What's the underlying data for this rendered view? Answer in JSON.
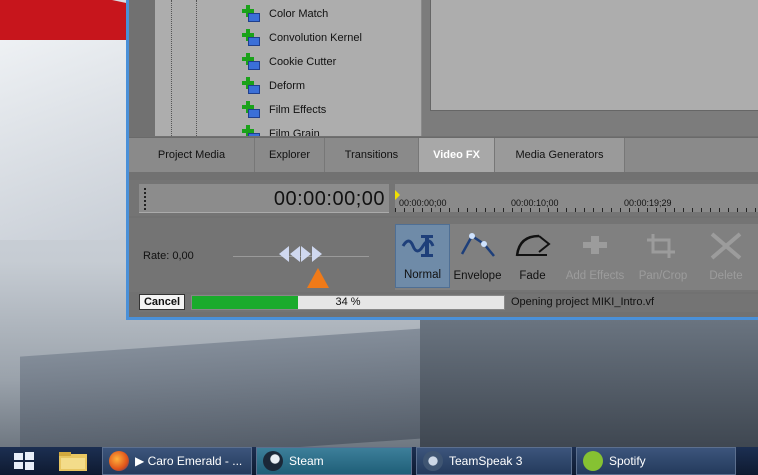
{
  "fx_list": {
    "items": [
      "Color Match",
      "Convolution Kernel",
      "Cookie Cutter",
      "Deform",
      "Film Effects",
      "Film Grain"
    ]
  },
  "tabs": [
    "Project Media",
    "Explorer",
    "Transitions",
    "Video FX",
    "Media Generators"
  ],
  "active_tab": "Video FX",
  "timeline": {
    "timecode": "00:00:00;00",
    "ruler_ticks": [
      "00:00:00;00",
      "00:00:10;00",
      "00:00:19;29"
    ]
  },
  "rate_label": "Rate: 0,00",
  "tools": {
    "normal": "Normal",
    "envelope": "Envelope",
    "fade": "Fade",
    "add_effects": "Add Effects",
    "pan_crop": "Pan/Crop",
    "delete": "Delete"
  },
  "status": {
    "cancel_label": "Cancel",
    "progress_value": 0.34,
    "progress_text": "34 %",
    "message": "Opening project MIKI_Intro.vf"
  },
  "taskbar": {
    "firefox_label": "▶ Caro Emerald - ...",
    "steam_label": "Steam",
    "teamspeak_label": "TeamSpeak 3",
    "spotify_label": "Spotify"
  },
  "colors": {
    "progress_fill": "#1aab2c",
    "shuttle_triangle": "#f07a18",
    "window_frame": "#4a90d8"
  }
}
